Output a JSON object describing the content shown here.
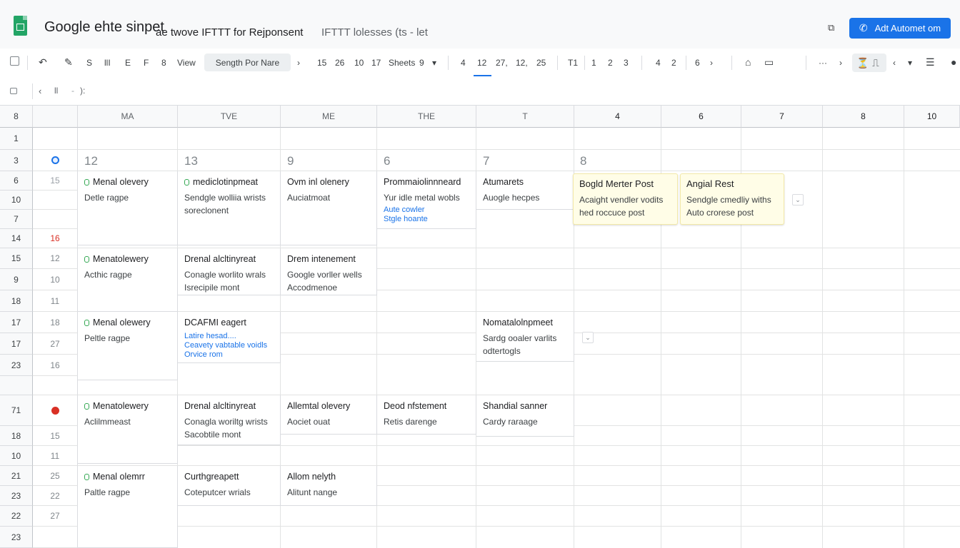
{
  "header": {
    "app_title": "Google ehte sinpet",
    "doc_title": "ae twove IFTTT for Rejponsent",
    "doc_subtitle": "IFTTT lolesses (ts - let",
    "primary_button": "Adt Automet om"
  },
  "toolbar": {
    "items_a": [
      "S",
      "llI",
      "E",
      "F",
      "8",
      "View"
    ],
    "font_select": "Sength Por Nare",
    "items_b": [
      "15",
      "26",
      "10",
      "17",
      "Sheets",
      "9"
    ],
    "items_c": [
      "4",
      "12",
      "27,",
      "12,",
      "25"
    ],
    "items_d": [
      "T1",
      "1",
      "2",
      "3",
      "4",
      "2",
      "6"
    ]
  },
  "formula_bar": {
    "text": "): "
  },
  "columns": [
    "MA",
    "TVE",
    "ME",
    "THE",
    "T",
    "4",
    "6",
    "7",
    "8",
    "10"
  ],
  "corner_label": "8",
  "rows": [
    {
      "label": "1",
      "sub": ""
    },
    {
      "label": "3",
      "sub": ""
    },
    {
      "label": "6",
      "sub": "15"
    },
    {
      "label": "10",
      "sub": ""
    },
    {
      "label": "7",
      "sub": ""
    },
    {
      "label": "14",
      "sub": "16"
    },
    {
      "label": "15",
      "sub": "12"
    },
    {
      "label": "9",
      "sub": "10"
    },
    {
      "label": "18",
      "sub": "11"
    },
    {
      "label": "17",
      "sub": "18"
    },
    {
      "label": "17",
      "sub": "27"
    },
    {
      "label": "23",
      "sub": "16"
    },
    {
      "label": "",
      "sub": ""
    },
    {
      "label": "71",
      "sub": ""
    },
    {
      "label": "18",
      "sub": "15"
    },
    {
      "label": "10",
      "sub": "11"
    },
    {
      "label": "21",
      "sub": "25"
    },
    {
      "label": "23",
      "sub": "22"
    },
    {
      "label": "22",
      "sub": "27"
    },
    {
      "label": "23",
      "sub": ""
    }
  ],
  "day_numbers": [
    "12",
    "13",
    "9",
    "6",
    "7",
    "8"
  ],
  "cards": {
    "c1": {
      "title": "Menal olevery",
      "line1": "Detle ragpe"
    },
    "c2": {
      "title": "mediclotinpmeat",
      "line1": "Sendgle wolliia wrists",
      "line2": "soreclonent"
    },
    "c3": {
      "title": "Ovm inl olenery",
      "line1": "Auciatmoat"
    },
    "c4": {
      "title": "Prommaiolinnneard",
      "line1": "Yur idle metal wobls",
      "blue1": "Aute cowler",
      "blue2": "Stgle hoante"
    },
    "c5": {
      "title": "Atumarets",
      "line1": "Auogle hecpes"
    },
    "c6": {
      "title": "Menatolewery",
      "line1": "Acthic ragpe"
    },
    "c7": {
      "title": "Drenal alcltinyreat",
      "line1": "Conagle worlito wrals",
      "line2": "Isrecipile mont"
    },
    "c8": {
      "title": "Drem intenement",
      "line1": "Google vorller wells",
      "line2": "Accodmenoe"
    },
    "c9": {
      "title": "Menal olewery",
      "line1": "Peltle ragpe"
    },
    "c10": {
      "title": "DCAFMI eagert",
      "blue1": "Latire hesad....",
      "blue2": "Ceavety vabtable voidls",
      "blue3": "Orvice rom"
    },
    "c11": {
      "title": "Nomatalolnpmeet",
      "line1": "Sardg ooaler varlits",
      "line2": "odtertogls"
    },
    "c12": {
      "title": "Menatolewery",
      "line1": "Aclilmmeast"
    },
    "c13": {
      "title": "Drenal alcltinyreat",
      "line1": "Conagla woriltg wrists",
      "line2": "Sacobtile mont"
    },
    "c14": {
      "title": "Allemtal olevery",
      "line1": "Aociet ouat"
    },
    "c15": {
      "title": "Deod nfstement",
      "line1": "Retis darenge"
    },
    "c16": {
      "title": "Shandial sanner",
      "line1": "Cardy raraage"
    },
    "c17": {
      "title": "Menal olemrr",
      "line1": "Paltle ragpe"
    },
    "c18": {
      "title": "Curthgreapett",
      "line1": "Coteputcer wrials"
    },
    "c19": {
      "title": "Allom nelyth",
      "line1": "Alitunt nange"
    }
  },
  "notes": {
    "n1": {
      "title": "Bogld Merter Post",
      "line1": "Acaight vendler vodits",
      "line2": "hed roccuce post"
    },
    "n2": {
      "title": "Angial Rest",
      "line1": "Sendgle cmedliy withs",
      "line2": "Auto crorese post"
    }
  },
  "colors": {
    "accent": "#1a73e8",
    "sheets_green": "#23a566",
    "note_bg": "#fffde7"
  }
}
